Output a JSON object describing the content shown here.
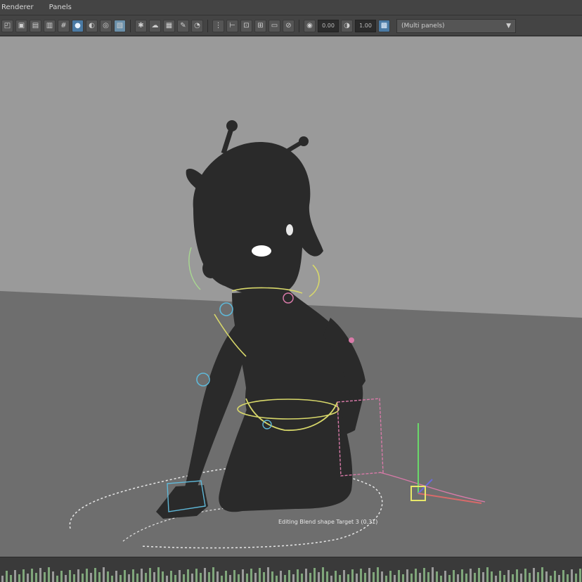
{
  "menubar": {
    "items": [
      "Renderer",
      "Panels"
    ]
  },
  "toolbar": {
    "icons": [
      "camera-select-icon",
      "camera-attributes-icon",
      "bookmark-icon",
      "image-plane-icon",
      "grid-icon",
      "film-gate-icon",
      "resolution-gate-icon",
      "gate-mask-icon",
      "field-chart-icon",
      "safe-action-icon",
      "safe-title-icon",
      "wireframe-icon",
      "smooth-shade-icon",
      "textured-icon",
      "lights-icon",
      "shadows-icon",
      "ambient-occlusion-icon",
      "motion-blur-icon",
      "anti-alias-icon",
      "depth-of-field-icon",
      "isolate-select-icon",
      "xray-icon",
      "xray-joints-icon",
      "backface-icon"
    ],
    "exposure_value": "0.00",
    "gamma_value": "1.00",
    "panel_select": "(Multi panels)"
  },
  "viewport": {
    "hud_text": "Editing Blend shape Target 3 (0.31)",
    "colors": {
      "background": "#9a9a9a",
      "ground": "#6e6e6e",
      "character": "#2a2a2a",
      "control_yellow": "#d8d86a",
      "control_cyan": "#5fb8d8",
      "control_pink": "#d87aa8",
      "control_white": "#e6e6e6"
    }
  },
  "timeslider": {
    "color": "#7fa67a"
  }
}
